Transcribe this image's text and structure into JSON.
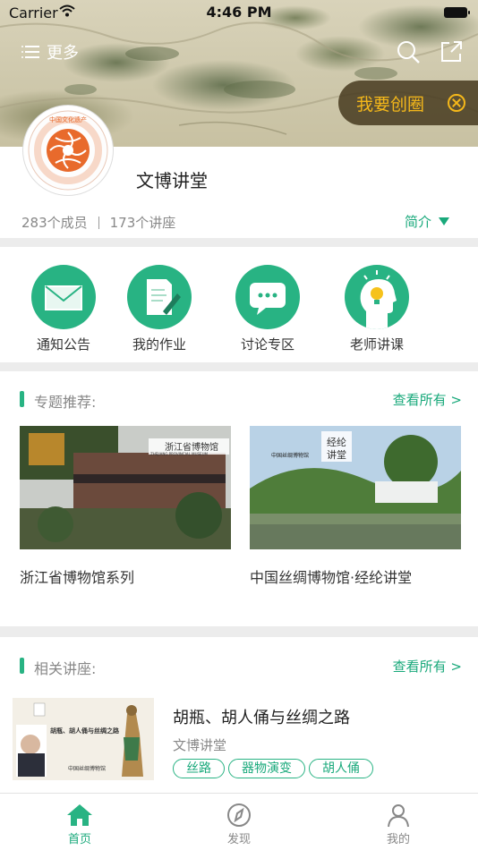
{
  "status_bar": {
    "carrier": "Carrier",
    "time": "4:46 PM"
  },
  "header": {
    "more_label": "更多",
    "create_circle_label": "我要创圈"
  },
  "group": {
    "title": "文博讲堂",
    "members": "283个成员",
    "lectures": "173个讲座",
    "intro_label": "简介",
    "logo_ring_text": "中国文化遗产 China Cultural Heritage"
  },
  "features": [
    {
      "label": "通知公告",
      "icon": "envelope-icon"
    },
    {
      "label": "我的作业",
      "icon": "homework-icon"
    },
    {
      "label": "讨论专区",
      "icon": "chat-bubble-icon"
    },
    {
      "label": "老师讲课",
      "icon": "lightbulb-head-icon"
    }
  ],
  "topics": {
    "title": "专题推荐:",
    "more": "查看所有 >",
    "cards": [
      {
        "label": "浙江省博物馆系列",
        "overlay": "浙江省博物馆",
        "overlay_en": "ZHEJIANG PROVINCIAL MUSEUM"
      },
      {
        "label": "中国丝绸博物馆·经纶讲堂",
        "overlay": "中国丝绸博物馆",
        "badge_line1": "经纶",
        "badge_line2": "讲堂"
      }
    ]
  },
  "lectures_section": {
    "title": "相关讲座:",
    "more": "查看所有 >",
    "items": [
      {
        "title": "胡瓶、胡人俑与丝绸之路",
        "subtitle": "文博讲堂",
        "tags": [
          "丝路",
          "器物演变",
          "胡人俑"
        ],
        "poster_title": "胡瓶、胡人俑与丝绸之路",
        "poster_museum": "中国丝绸博物馆"
      }
    ]
  },
  "tabbar": [
    {
      "label": "首页",
      "icon": "home-icon",
      "active": true
    },
    {
      "label": "发现",
      "icon": "compass-icon",
      "active": false
    },
    {
      "label": "我的",
      "icon": "person-icon",
      "active": false
    }
  ],
  "colors": {
    "accent": "#28b383",
    "accent_text": "#19a97b",
    "create_bg": "#463a1e",
    "create_text": "#f5b81a"
  }
}
